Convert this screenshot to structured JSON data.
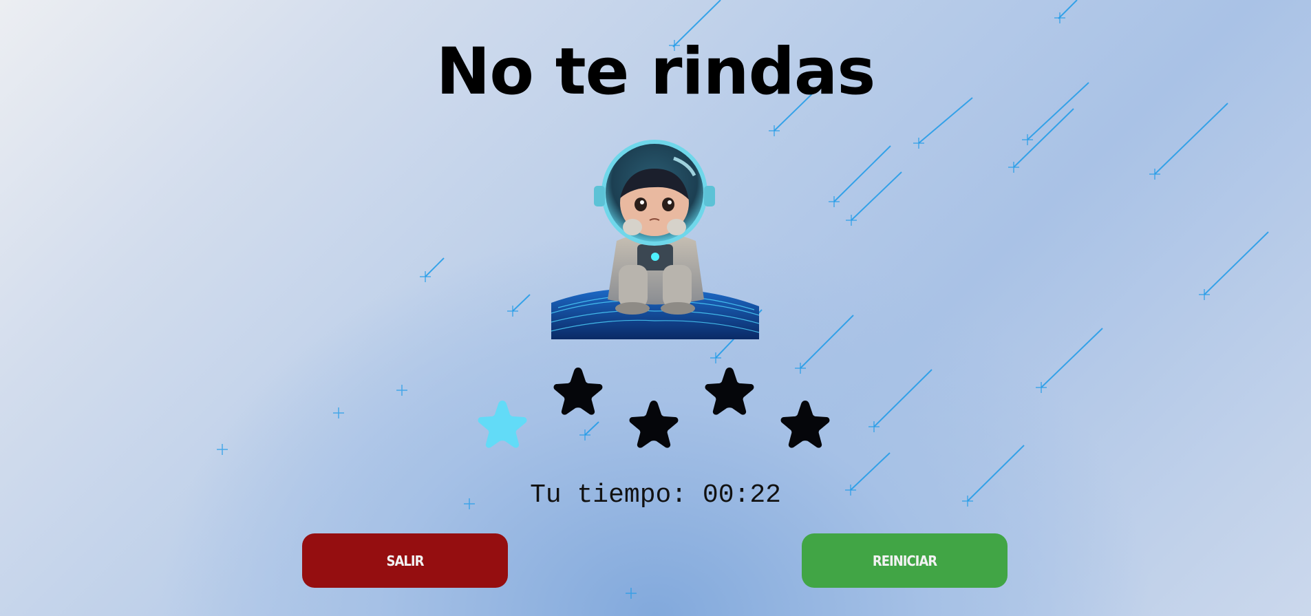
{
  "title": "No te rindas",
  "avatar": {
    "icon": "astronaut-icon"
  },
  "rating": {
    "max": 5,
    "earned": 1,
    "earned_color": "#62dbf7",
    "empty_color": "#05060a"
  },
  "timer": {
    "label": "Tu tiempo: 00:22"
  },
  "buttons": {
    "exit_label": "SALIR",
    "exit_color": "#950e10",
    "restart_label": "REINICIAR",
    "restart_color": "#41a545"
  },
  "colors": {
    "shooting_star": "#1e9be8",
    "background_light": "#eceef2",
    "background_mid": "#a9c2e6"
  }
}
